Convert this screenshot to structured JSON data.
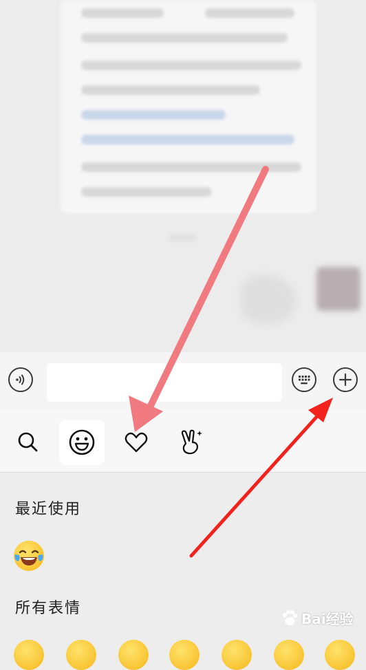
{
  "input": {
    "placeholder": ""
  },
  "tabs": [
    {
      "id": "search",
      "icon": "search-icon"
    },
    {
      "id": "emoji",
      "icon": "smiley-icon",
      "active": true
    },
    {
      "id": "favorites",
      "icon": "heart-icon"
    },
    {
      "id": "stickers",
      "icon": "victory-hand-icon"
    }
  ],
  "panel": {
    "recent_title": "最近使用",
    "all_title": "所有表情"
  },
  "watermark": {
    "text": "Bai经验"
  },
  "colors": {
    "arrow_pink": "#f07a80",
    "arrow_red": "#f2231d",
    "panel_bg": "#ededed"
  }
}
